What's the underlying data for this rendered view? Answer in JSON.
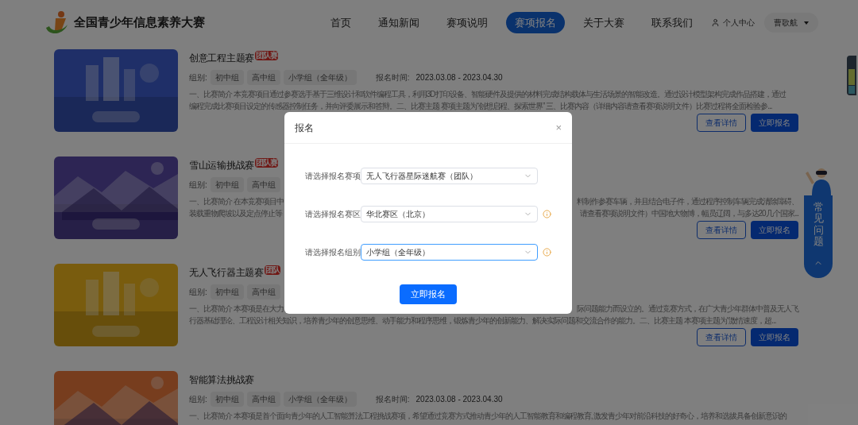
{
  "header": {
    "site_title": "全国青少年信息素养大赛",
    "nav": [
      {
        "label": "首页",
        "selected": false
      },
      {
        "label": "通知新闻",
        "selected": false
      },
      {
        "label": "赛项说明",
        "selected": false
      },
      {
        "label": "赛项报名",
        "selected": true
      },
      {
        "label": "关于大赛",
        "selected": false
      },
      {
        "label": "联系我们",
        "selected": false
      }
    ],
    "user_center": "个人中心",
    "user_name": "曹歌航"
  },
  "cards": [
    {
      "title": "创意工程主题赛",
      "badge": "团队赛",
      "groups_label": "组别:",
      "groups": [
        "初中组",
        "高中组",
        "小学组（全年级）"
      ],
      "date_label": "报名时间:",
      "date": "2023.03.08 - 2023.04.30",
      "description": [
        [
          "一、比赛简介 本竞赛项目通过参赛选手基于三维设计和软件编程工具，利用3D打印设备、智能硬件及提供的材料完成结构载体与生活场景的智能改造。通过设计模型架构完成作品搭建，通过"
        ],
        [
          "编程完成比赛项目设定的传感器控制任务，并向评委展示和答辩。二、比赛主题 赛项主题为“创想启程、探索世界” 三、比赛内容（详细内容请查看赛项说明文件）比赛过程将全面检验参..."
        ]
      ],
      "buttons": [
        "查看详情",
        "立即报名"
      ]
    },
    {
      "title": "雪山运输挑战赛",
      "badge": "团队赛",
      "groups_label": "组别:",
      "groups": [
        "初中组",
        "高中组"
      ],
      "description": [
        [
          "一、比赛简介 在本竞赛项目中",
          "料制作参赛车辆，并且结合电子件，通过程序控制车辆完成清除障碍、"
        ],
        [
          "装载重物爬坡以及定点停止等",
          "请查看赛项说明文件）中国地大物博，幅员辽阔，与多达20几个国家..."
        ]
      ],
      "buttons": [
        "查看详情",
        "立即报名"
      ]
    },
    {
      "title": "无人飞行器主题赛",
      "badge": "团队",
      "groups_label": "组别:",
      "groups": [
        "初中组",
        "高中组"
      ],
      "description": [
        [
          "一、比赛简介 本赛项是在大力",
          "际问题能力而设立的。通过竞赛方式，在广大青少年群体中普及无人飞"
        ],
        [
          "行器基础理论、工程设计相关知识，培养青少年的创意思维、动手能力和程序思维，锻炼青少年的创新能力、解决实际问题和交流合作的能力。二、比赛主题 本赛项主题为“激情速度，超..."
        ]
      ],
      "buttons": [
        "查看详情",
        "立即报名"
      ]
    },
    {
      "title": "智能算法挑战赛",
      "groups_label": "组别:",
      "groups": [
        "初中组",
        "高中组",
        "小学组（全年级）"
      ],
      "date_label": "报名时间:",
      "date": "2023.03.08 - 2023.04.30",
      "description": [
        [
          "一、比赛简介 本赛项是首个面向青少年的人工智能算法工程挑战赛项，希望通过竞赛方式推动青少年的人工智能教育和编程教育, 激发青少年对前沿科技的好奇心，培养和选拔具备创新意识的"
        ]
      ]
    }
  ],
  "faq": {
    "label": "常见问题"
  },
  "dialog": {
    "title": "报名",
    "close": "×",
    "fields": [
      {
        "label": "请选择报名赛项",
        "value": "无人飞行器星际迷航赛（团队）",
        "warning": false,
        "focused": false
      },
      {
        "label": "请选择报名赛区",
        "value": "华北赛区（北京）",
        "warning": true,
        "focused": false
      },
      {
        "label": "请选择报名组别",
        "value": "小学组（全年级）",
        "warning": true,
        "focused": true
      }
    ],
    "submit": "立即报名"
  }
}
